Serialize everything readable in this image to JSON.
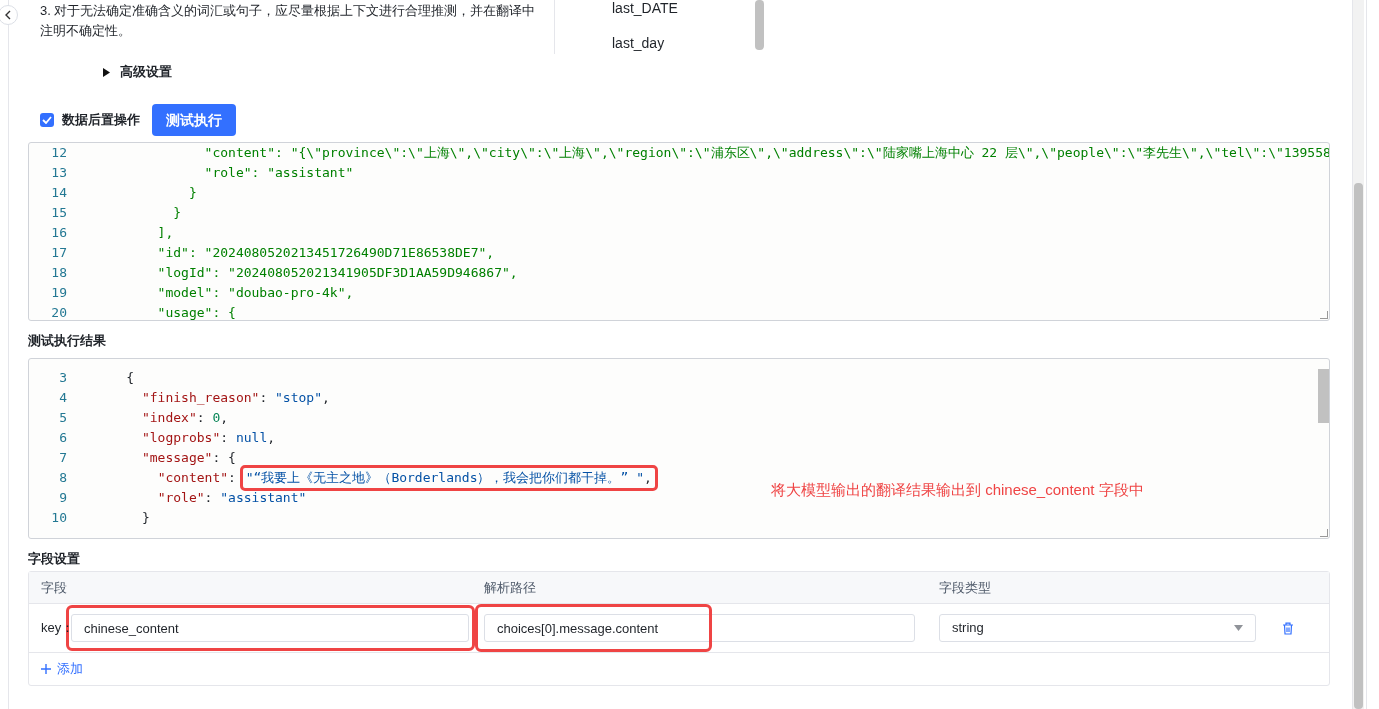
{
  "intro_text": "3. 对于无法确定准确含义的词汇或句子，应尽量根据上下文进行合理推测，并在翻译中注明不确定性。",
  "variable_list": {
    "items": [
      "last_DATE",
      "last_day"
    ]
  },
  "advanced_settings": {
    "label": "高级设置",
    "expanded": false
  },
  "post_processing": {
    "label": "数据后置操作",
    "checked": true
  },
  "run_button": "测试执行",
  "input_editor": {
    "kind": "plain",
    "lines": [
      {
        "number": "12",
        "text": "              \"content\": \"{\\\"province\\\":\\\"上海\\\",\\\"city\\\":\\\"上海\\\",\\\"region\\\":\\\"浦东区\\\",\\\"address\\\":\\\"陆家嘴上海中心 22 层\\\",\\\"people\\\":\\\"李先生\\\",\\\"tel\\\":\\\"139558"
      },
      {
        "number": "13",
        "text": "              \"role\": \"assistant\""
      },
      {
        "number": "14",
        "text": "            }"
      },
      {
        "number": "15",
        "text": "          }"
      },
      {
        "number": "16",
        "text": "        ],"
      },
      {
        "number": "17",
        "text": "        \"id\": \"2024080520213451726490D71E86538DE7\","
      },
      {
        "number": "18",
        "text": "        \"logId\": \"202408052021341905DF3D1AA59D946867\","
      },
      {
        "number": "19",
        "text": "        \"model\": \"doubao-pro-4k\","
      },
      {
        "number": "20",
        "text": "        \"usage\": {"
      }
    ]
  },
  "result_title": "测试执行结果",
  "result_editor": {
    "kind": "json",
    "lines": [
      {
        "number": "3",
        "text": "    {"
      },
      {
        "number": "4",
        "text": "      \"finish_reason\": \"stop\","
      },
      {
        "number": "5",
        "text": "      \"index\": 0,"
      },
      {
        "number": "6",
        "text": "      \"logprobs\": null,"
      },
      {
        "number": "7",
        "text": "      \"message\": {"
      },
      {
        "number": "8",
        "text": "        \"content\": ",
        "marked_value": "\"“我要上《无主之地》（Borderlands），我会把你们都干掉。” \","
      },
      {
        "number": "9",
        "text": "        \"role\": \"assistant\""
      },
      {
        "number": "10",
        "text": "      }"
      }
    ]
  },
  "annotation": "将大模型输出的翻译结果输出到 chinese_content 字段中",
  "field_settings": {
    "title": "字段设置",
    "columns": [
      "字段",
      "解析路径",
      "字段类型"
    ],
    "rows": [
      {
        "key_label": "key：",
        "key": "chinese_content",
        "key_marked": true,
        "path": "choices[0].message.content",
        "path_marked": true,
        "type": "string"
      }
    ],
    "add_label": "添加"
  }
}
